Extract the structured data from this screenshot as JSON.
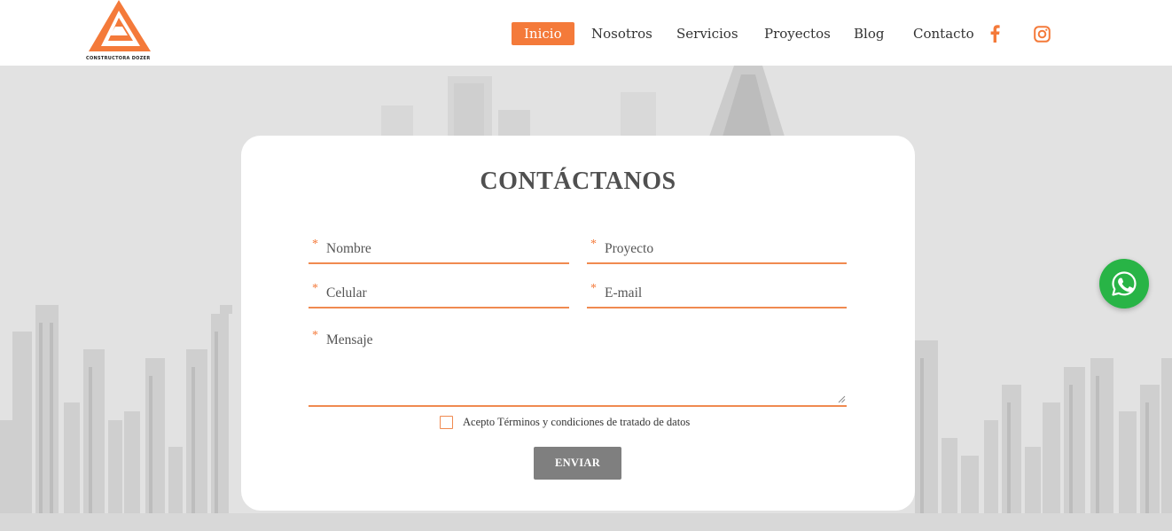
{
  "brand": {
    "name": "CONSTRUCTORA DOZER",
    "accent": "#f47a3a"
  },
  "nav": {
    "items": [
      {
        "label": "Inicio",
        "active": true
      },
      {
        "label": "Nosotros",
        "active": false
      },
      {
        "label": "Servicios",
        "active": false
      },
      {
        "label": "Proyectos",
        "active": false
      },
      {
        "label": "Blog",
        "active": false
      },
      {
        "label": "Contacto",
        "active": false
      }
    ],
    "social": [
      {
        "icon": "facebook-icon"
      },
      {
        "icon": "instagram-icon"
      }
    ]
  },
  "form": {
    "title": "CONTÁCTANOS",
    "required_mark": "*",
    "fields": {
      "name": "Nombre",
      "project": "Proyecto",
      "phone": "Celular",
      "email": "E-mail",
      "message": "Mensaje"
    },
    "terms_label": "Acepto Términos y condiciones de tratado de datos",
    "terms_checked": false,
    "submit_label": "ENVIAR"
  },
  "whatsapp": {
    "icon": "whatsapp-icon",
    "color": "#28b446"
  }
}
